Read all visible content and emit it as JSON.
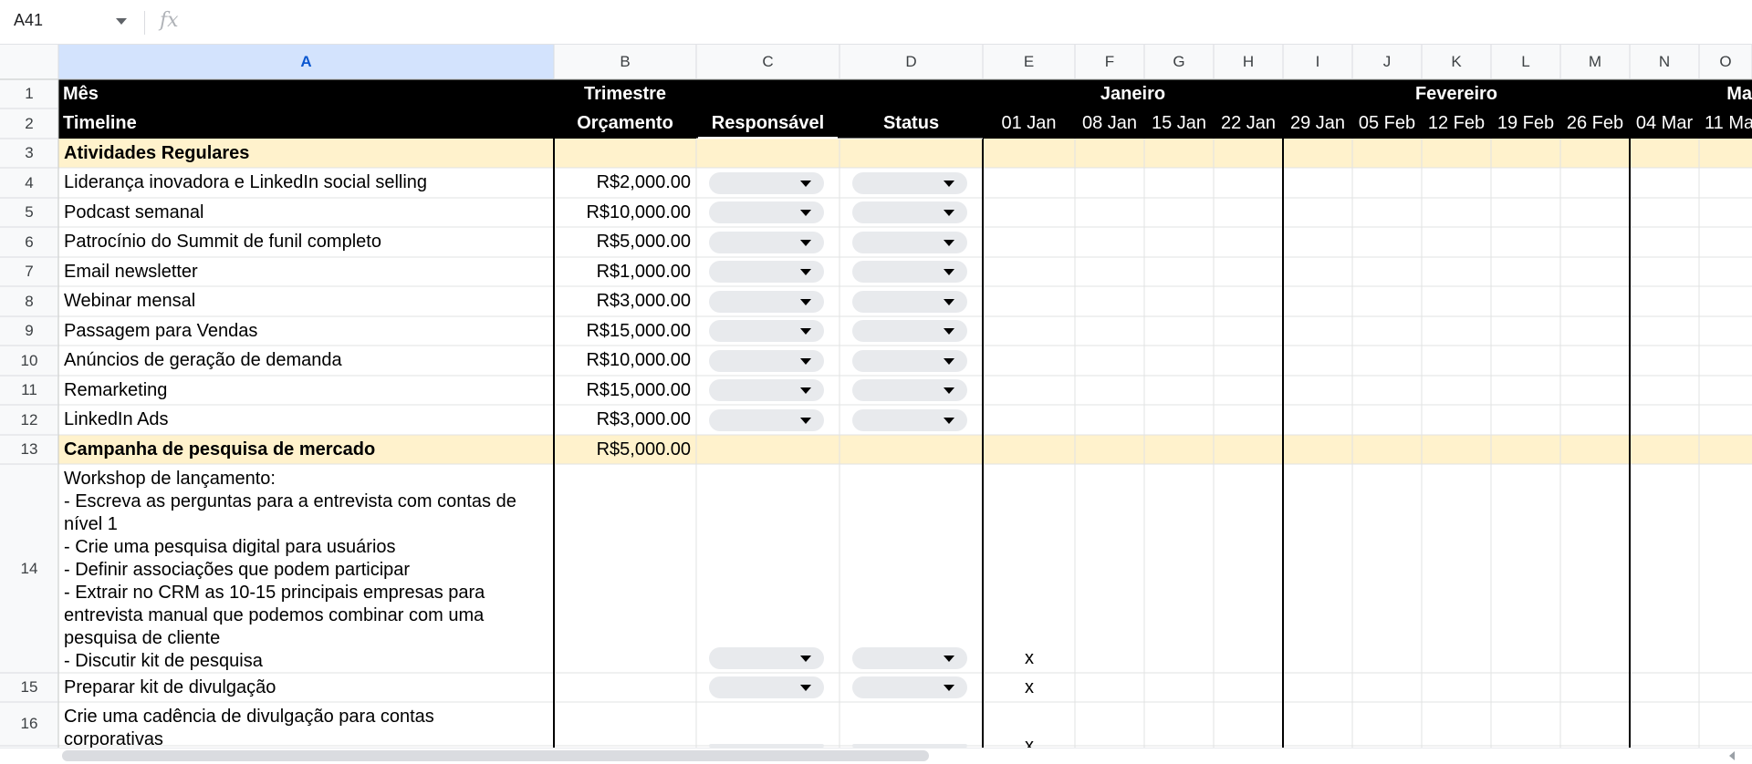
{
  "formula_bar": {
    "cell_ref": "A41",
    "fx_label": "fx"
  },
  "columns": [
    "A",
    "B",
    "C",
    "D",
    "E",
    "F",
    "G",
    "H",
    "I",
    "J",
    "K",
    "L",
    "M",
    "N",
    "O"
  ],
  "rows": [
    "1",
    "2",
    "3",
    "4",
    "5",
    "6",
    "7",
    "8",
    "9",
    "10",
    "11",
    "12",
    "13",
    "14",
    "15",
    "16"
  ],
  "header_row1": {
    "a": "Mês",
    "b": "Trimestre",
    "janeiro": "Janeiro",
    "fevereiro": "Fevereiro",
    "marco_partial": "Ma"
  },
  "header_row2": {
    "a": "Timeline",
    "b": "Orçamento",
    "c": "Responsável",
    "d": "Status",
    "dates": [
      "01 Jan",
      "08 Jan",
      "15 Jan",
      "22 Jan",
      "29 Jan",
      "05 Feb",
      "12 Feb",
      "19 Feb",
      "26 Feb",
      "04 Mar",
      "11 Ma"
    ]
  },
  "section1": "Atividades Regulares",
  "activities": [
    {
      "name": "Liderança inovadora e LinkedIn social selling",
      "budget": "R$2,000.00"
    },
    {
      "name": "Podcast semanal",
      "budget": "R$10,000.00"
    },
    {
      "name": "Patrocínio do Summit de funil completo",
      "budget": "R$5,000.00"
    },
    {
      "name": "Email newsletter",
      "budget": "R$1,000.00"
    },
    {
      "name": "Webinar mensal",
      "budget": "R$3,000.00"
    },
    {
      "name": "Passagem para Vendas",
      "budget": "R$15,000.00"
    },
    {
      "name": "Anúncios de geração de demanda",
      "budget": "R$10,000.00"
    },
    {
      "name": "Remarketing",
      "budget": "R$15,000.00"
    },
    {
      "name": "LinkedIn Ads",
      "budget": "R$3,000.00"
    }
  ],
  "section2": {
    "name": "Campanha de pesquisa de mercado",
    "budget": "R$5,000.00"
  },
  "row14_lines": [
    "Workshop de lançamento:",
    "- Escreva as perguntas para a entrevista com contas de",
    "nível 1",
    "- Crie uma pesquisa digital para usuários",
    "- Definir associações que podem participar",
    "- Extrair no CRM as 10-15 principais empresas para",
    "entrevista manual que podemos combinar com uma",
    "pesquisa de cliente",
    "- Discutir kit de pesquisa"
  ],
  "row14_mark": "x",
  "row15": {
    "name": "Preparar kit de divulgação",
    "mark": "x"
  },
  "row16": {
    "line1": "Crie uma cadência de divulgação para contas",
    "line2": "corporativas",
    "mark": "x"
  }
}
